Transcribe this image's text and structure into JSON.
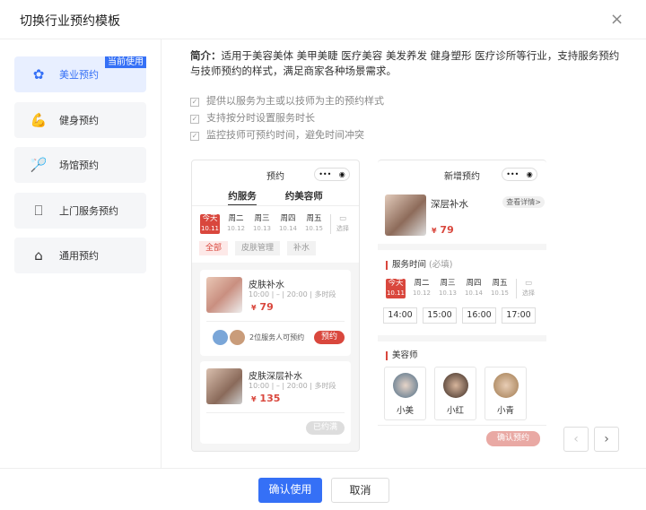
{
  "dialog": {
    "title": "切换行业预约模板",
    "close_icon": "×"
  },
  "sidebar": {
    "items": [
      {
        "label": "美业预约",
        "icon": "beauty-icon",
        "glyph": "✿",
        "badge": "当前使用"
      },
      {
        "label": "健身预约",
        "icon": "arm-icon",
        "glyph": "💪"
      },
      {
        "label": "场馆预约",
        "icon": "shuttlecock-icon",
        "glyph": "🏸"
      },
      {
        "label": "上门服务预约",
        "icon": "door-icon",
        "glyph": "⎕"
      },
      {
        "label": "通用预约",
        "icon": "store-icon",
        "glyph": "⌂"
      }
    ]
  },
  "intro": {
    "label": "简介：",
    "text": "适用于美容美体 美甲美睫 医疗美容 美发养发 健身塑形 医疗诊所等行业，支持服务预约与技师预约的样式，满足商家各种场景需求。"
  },
  "features": [
    "提供以服务为主或以技师为主的预约样式",
    "支持按分时设置服务时长",
    "监控技师可预约时间，避免时间冲突"
  ],
  "days": [
    {
      "d": "今天",
      "n": "10.11"
    },
    {
      "d": "周二",
      "n": "10.12"
    },
    {
      "d": "周三",
      "n": "10.13"
    },
    {
      "d": "周四",
      "n": "10.14"
    },
    {
      "d": "周五",
      "n": "10.15"
    }
  ],
  "pick_label": "选择",
  "phone1": {
    "title": "预约",
    "capsule": "•••",
    "tabs": [
      "约服务",
      "约美容师"
    ],
    "chips": [
      "全部",
      "皮肤管理",
      "补水"
    ],
    "cards": [
      {
        "name": "皮肤补水",
        "start": "10:00",
        "dash": "–",
        "end": "20:00",
        "multi": "多时段",
        "currency": "¥",
        "price": "79",
        "staff": "2位服务人可预约",
        "action": "预约"
      },
      {
        "name": "皮肤深层补水",
        "start": "10:00",
        "dash": "–",
        "end": "20:00",
        "multi": "多时段",
        "currency": "¥",
        "price": "135",
        "action": "已约满"
      }
    ]
  },
  "phone2": {
    "title": "新增预约",
    "capsule": "•••",
    "item": "深层补水",
    "detail": "查看详情>",
    "currency": "¥",
    "price": "79",
    "time_label": "服务时间",
    "required": "(必填)",
    "slots": [
      "14:00",
      "15:00",
      "16:00",
      "17:00"
    ],
    "staff_label": "美容师",
    "staff": [
      "小美",
      "小红",
      "小青"
    ],
    "confirm": "确认预约"
  },
  "footer": {
    "confirm": "确认使用",
    "cancel": "取消"
  },
  "colors": {
    "accent": "#3570f6",
    "brand_red": "#d9473d"
  }
}
